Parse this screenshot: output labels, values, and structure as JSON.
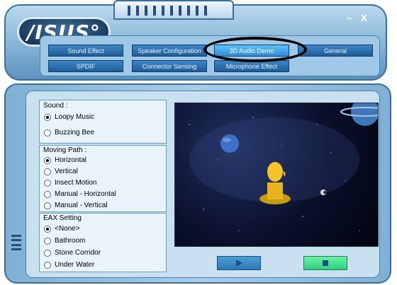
{
  "brand": {
    "logo_text": "/ISUS°"
  },
  "window_controls": {
    "minimize": "–",
    "close": "X"
  },
  "tabs": {
    "row1": [
      "Sound Effect",
      "Speaker Configuration",
      "3D Audio Demo",
      "General"
    ],
    "row2": [
      "SPDIF",
      "Connector Sensing",
      "Microphone Effect"
    ],
    "selected": "3D Audio Demo"
  },
  "sound": {
    "title": "Sound :",
    "options": [
      {
        "label": "Loopy Music",
        "selected": true
      },
      {
        "label": "Buzzing Bee",
        "selected": false
      }
    ]
  },
  "moving_path": {
    "title": "Moving Path :",
    "options": [
      {
        "label": "Horizontal",
        "selected": true
      },
      {
        "label": "Vertical",
        "selected": false
      },
      {
        "label": "Insect Motion",
        "selected": false
      },
      {
        "label": "Manual - Horizontal",
        "selected": false
      },
      {
        "label": "Manual - Vertical",
        "selected": false
      }
    ]
  },
  "eax": {
    "title": "EAX Setting",
    "options": [
      {
        "label": "<None>",
        "selected": true
      },
      {
        "label": "Bathroom",
        "selected": false
      },
      {
        "label": "Stone Corridor",
        "selected": false
      },
      {
        "label": "Under Water",
        "selected": false
      }
    ]
  },
  "controls": {
    "play_icon": "play-icon",
    "stop_icon": "stop-icon"
  },
  "colors": {
    "frame": "#7fb0d3",
    "tab_button": "#2c6fae",
    "selected_tab": "#3aa3ec",
    "play": "#3a8fd0",
    "stop": "#3fe08f"
  }
}
